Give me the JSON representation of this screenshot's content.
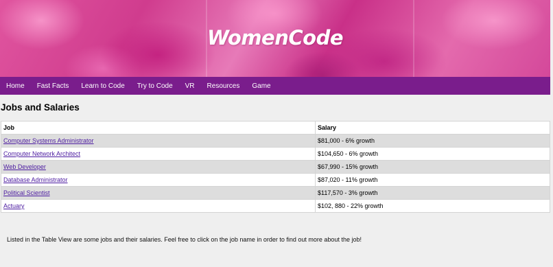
{
  "site": {
    "brand": "WomenCode"
  },
  "nav": {
    "items": [
      "Home",
      "Fast Facts",
      "Learn to Code",
      "Try to Code",
      "VR",
      "Resources",
      "Game"
    ]
  },
  "main": {
    "title": "Jobs and Salaries",
    "table": {
      "headers": [
        "Job",
        "Salary"
      ],
      "rows": [
        {
          "job": "Computer Systems Administrator",
          "salary": "$81,000 - 6% growth"
        },
        {
          "job": "Computer Network Architect",
          "salary": "$104,650 - 6% growth"
        },
        {
          "job": "Web Developer",
          "salary": "$67,990 - 15% growth"
        },
        {
          "job": "Database Administrator",
          "salary": "$87,020 - 11% growth"
        },
        {
          "job": "Political Scientist",
          "salary": "$117,570 - 3% growth"
        },
        {
          "job": "Actuary",
          "salary": "$102, 880 - 22% growth"
        }
      ]
    },
    "description": "Listed in the Table View are some jobs and their salaries. Feel free to click on the job name in order to find out more about the job!"
  },
  "colors": {
    "nav_background": "#7a1d8c",
    "banner_pink": "#d03c8e",
    "link": "#4b1aa0",
    "striped_row": "#dddddd",
    "page_background": "#efefef"
  }
}
